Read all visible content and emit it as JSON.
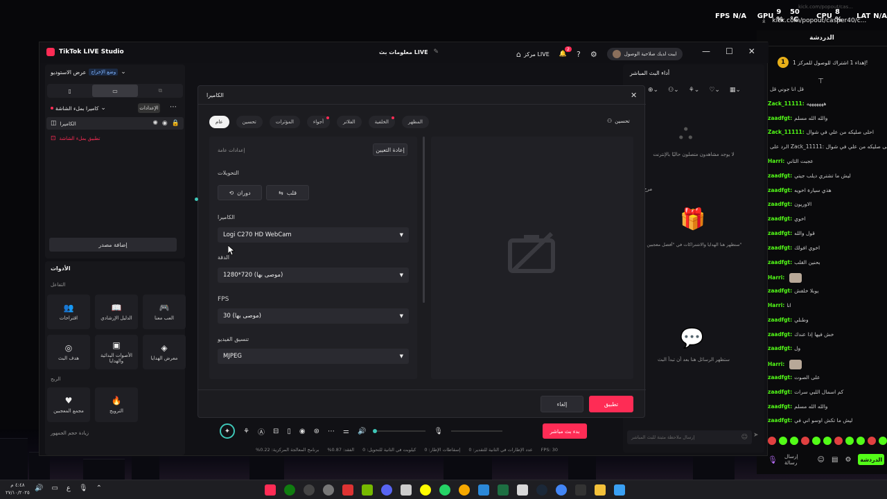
{
  "overlay": {
    "fps_label": "FPS",
    "fps_value": "N/A",
    "gpu_label": "GPU",
    "gpu_value": "9 %",
    "gpu_temp": "50 °C",
    "cpu_label": "CPU",
    "cpu_value": "8 %",
    "lat_label": "LAT",
    "lat_value": "N/A"
  },
  "browser": {
    "url": "kick.com/popout/casper40/c...",
    "url_faint": "kick.com/popout/cas..."
  },
  "app": {
    "title": "TikTok LIVE Studio",
    "center_title": "معلومات بث LIVE",
    "live_center": "مركز LIVE",
    "notif_count": "2",
    "profile_text": "ايبت لديك صلاحية الوصول"
  },
  "left": {
    "studio_label": "عرض الاستوديو",
    "studio_badge": "وضع الإخراج",
    "scene_name": "كاميرا بملء الشاشة",
    "settings_tip": "الإعدادات",
    "source_camera": "الكاميرا",
    "source_app": "تطبيق بملء الشاشة",
    "add_source": "إضافة مصدر",
    "tools_title": "الأدوات",
    "section_interact": "التفاعل",
    "tools_interact": [
      {
        "label": "اقتراحات",
        "icon": "👥"
      },
      {
        "label": "الدليل الإرشادي",
        "icon": "📖"
      },
      {
        "label": "العب معنا",
        "icon": "🎮"
      },
      {
        "label": "هدف البث",
        "icon": "◎"
      },
      {
        "label": "الأصوات البدائية والهدايا",
        "icon": "▣"
      },
      {
        "label": "معرض الهدايا",
        "icon": "◈"
      }
    ],
    "section_profit": "الربح",
    "tools_profit": [
      {
        "label": "مجمع المعجبين",
        "icon": "♥"
      },
      {
        "label": "الترويج",
        "icon": "🔥"
      }
    ],
    "section_audience": "زيادة حجم الجمهور"
  },
  "dialog": {
    "title": "الكاميرا",
    "enhance": "تحسين",
    "tabs": [
      "عام",
      "تحسين",
      "المؤثرات",
      "أجواء",
      "الفلاتر",
      "الخلفية",
      "المظهر"
    ],
    "tabs_dot": [
      false,
      false,
      false,
      true,
      false,
      true,
      false
    ],
    "general_settings": "إعدادات عامة",
    "reset": "إعادة التعيين",
    "transforms_label": "التحويلات",
    "rotate": "دوران",
    "flip": "قلب",
    "camera_label": "الكاميرا",
    "camera_value": "Logi C270 HD WebCam",
    "resolution_label": "الدقة",
    "resolution_value": "1280*720 (موصى بها)",
    "fps_label": "FPS",
    "fps_value": "30 (موصى بها)",
    "format_label": "تنسيق الفيديو",
    "format_value": "MJPEG",
    "cancel": "إلغاء",
    "apply": "تطبيق"
  },
  "rightpanel": {
    "title": "أداء البث المباشر",
    "no_viewers": "لا يوجد مشاهدون متصلون حاليًا بالإنترنت",
    "gifts_hint": "ستظهر هنا الهدايا والاشتراكات في \"أفضل معجبين\"",
    "msgs_hint": "ستظهر الرسائل هنا بعد أن تبدأ البث",
    "section_short": "مرح",
    "chat_placeholder": "إرسال ملاحظة مثبتة للبث المباشر"
  },
  "bottombar": {
    "go_live": "بدء بث مباشر",
    "stats": [
      "FPS: 30",
      "عدد الإطارات في الثانية للتقدير: 0",
      "إسقاطات الإطار: 0",
      "كيلوبت في الثانية للتحويل: 0",
      "الفقد: 0.87%",
      "برنامج المعالجة المركزية: 0.22%"
    ]
  },
  "chat": {
    "header": "الدردشة",
    "top_banner": "إهداء 1 اشتراك للوصول للمركز 1!",
    "top_rank": "1",
    "messages": [
      {
        "user": "",
        "text": "قل انا جوني قل"
      },
      {
        "user": "Zack_11111:",
        "text": "هههههههه"
      },
      {
        "user": "zaadfgt:",
        "text": "والله الله مسلم"
      },
      {
        "user": "Zack_11111:",
        "text": "احلى صليكه من علي في شوال"
      },
      {
        "user": "",
        "text": "الرد على Zack_11111: احلى صليكه من علي في شوال"
      },
      {
        "user": "Harri:",
        "text": "عجبت الثاني"
      },
      {
        "user": "zaadfgt:",
        "text": "ليش ما تشتري ديلب جيتي"
      },
      {
        "user": "zaadfgt:",
        "text": "هذي سيارة اخويه"
      },
      {
        "user": "zaadfgt:",
        "text": "الاوريون"
      },
      {
        "user": "zaadfgt:",
        "text": "اخوي"
      },
      {
        "user": "zaadfgt:",
        "text": "قول والله"
      },
      {
        "user": "zaadfgt:",
        "text": "اخوي افولك"
      },
      {
        "user": "zaadfgt:",
        "text": "بحنين القلب"
      },
      {
        "user": "Harri:",
        "text": ""
      },
      {
        "user": "zaadfgt:",
        "text": "يوبلا خلفش"
      },
      {
        "user": "Harri:",
        "text": "انا"
      },
      {
        "user": "zaadfgt:",
        "text": "وطنلي"
      },
      {
        "user": "zaadfgt:",
        "text": "خش فيها إذا عندك"
      },
      {
        "user": "zaadfgt:",
        "text": "ول"
      },
      {
        "user": "Harri:",
        "text": ""
      },
      {
        "user": "zaadfgt:",
        "text": "على الصوت"
      },
      {
        "user": "zaadfgt:",
        "text": "كم اسمال اللبي سرات"
      },
      {
        "user": "zaadfgt:",
        "text": "والله الله مسلم"
      },
      {
        "user": "zaadfgt:",
        "text": "ليش ما تكش اوسو اني في"
      }
    ],
    "send_label": "إرسال رسالة",
    "chat_button": "الدردشة"
  },
  "taskbar": {
    "time": "٤:٤٨ م",
    "date": "٢٧/١٠/٢٠٢٥",
    "lang": "ع"
  }
}
